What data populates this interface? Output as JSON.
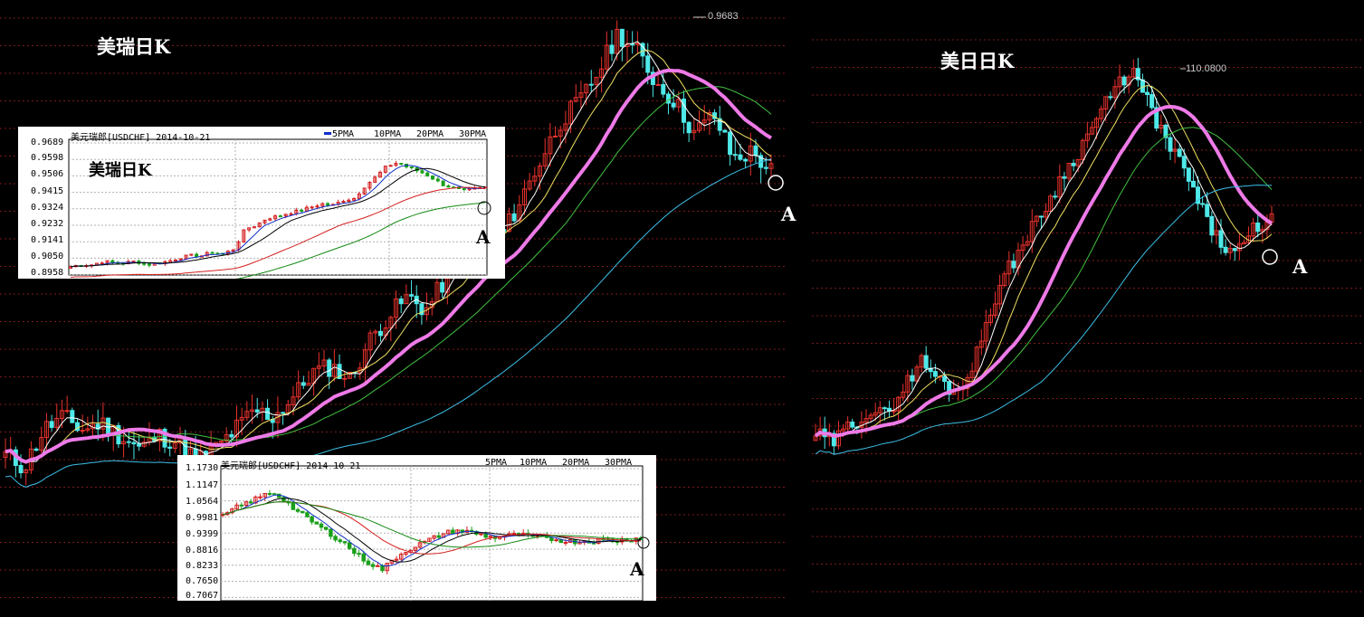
{
  "colors": {
    "bg": "#000000",
    "up": "#e8322c",
    "down": "#4ee8e8",
    "ma5": "#ffffff",
    "ma10": "#f0e060",
    "ma20": "#e84a8c",
    "ma30": "#40c040",
    "ma60": "#3cc0e8",
    "thick": "#ee7ae8",
    "inset_ma5": "#1030c8",
    "inset_ma10": "#000000",
    "inset_ma20": "#d42020",
    "inset_ma30": "#148a14"
  },
  "left_chart": {
    "title": "美瑞日K",
    "peak_label": "0.9683",
    "marker": "A"
  },
  "right_chart": {
    "title": "美日日K",
    "peak_label": "110.0800",
    "marker": "A"
  },
  "inset_chf": {
    "header": "美元瑞郎[USDCHF] 2014-10-21",
    "legend": [
      "5PMA",
      "10PMA",
      "20PMA",
      "30PMA"
    ],
    "yticks": [
      "0.9689",
      "0.9598",
      "0.9506",
      "0.9415",
      "0.9324",
      "0.9232",
      "0.9141",
      "0.9050",
      "0.8958"
    ],
    "title": "美瑞日K",
    "marker": "A"
  },
  "inset_long": {
    "header": "美元瑞郎[USDCHF] 2014-10-21",
    "legend": [
      "5PMA",
      "10PMA",
      "20PMA",
      "30PMA"
    ],
    "yticks": [
      "1.1730",
      "1.1147",
      "1.0564",
      "0.9981",
      "0.9399",
      "0.8816",
      "0.8233",
      "0.7650",
      "0.7067"
    ],
    "marker": "A"
  },
  "chart_data": [
    {
      "type": "candlestick",
      "title": "美瑞日K",
      "peak_label": "0.9683",
      "close_path": [
        0.899,
        0.897,
        0.903,
        0.905,
        0.903,
        0.904,
        0.902,
        0.9,
        0.902,
        0.901,
        0.898,
        0.9,
        0.903,
        0.906,
        0.905,
        0.908,
        0.912,
        0.913,
        0.911,
        0.917,
        0.921,
        0.924,
        0.922,
        0.927,
        0.932,
        0.936,
        0.934,
        0.94,
        0.946,
        0.952,
        0.955,
        0.96,
        0.966,
        0.963,
        0.958,
        0.955,
        0.95,
        0.953,
        0.946,
        0.947,
        0.944
      ],
      "markers": [
        "A"
      ]
    },
    {
      "type": "candlestick",
      "title": "美日日K",
      "peak_label": "110.0800",
      "close_path": [
        102.0,
        101.8,
        102.2,
        102.5,
        102.4,
        103.0,
        103.6,
        103.2,
        102.9,
        103.5,
        104.8,
        105.6,
        106.3,
        106.9,
        107.6,
        108.2,
        108.9,
        109.5,
        110.0,
        109.2,
        108.4,
        107.8,
        106.9,
        106.2,
        105.9,
        106.5,
        106.7
      ],
      "markers": [
        "A"
      ]
    },
    {
      "type": "candlestick",
      "title": "美瑞日K",
      "series": [
        {
          "name": "5PMA"
        },
        {
          "name": "10PMA"
        },
        {
          "name": "20PMA"
        },
        {
          "name": "30PMA"
        }
      ],
      "ylim": [
        0.8958,
        0.9689
      ],
      "close_path": [
        0.9,
        0.901,
        0.901,
        0.903,
        0.902,
        0.902,
        0.903,
        0.901,
        0.902,
        0.903,
        0.905,
        0.906,
        0.906,
        0.908,
        0.907,
        0.91,
        0.921,
        0.923,
        0.927,
        0.928,
        0.93,
        0.931,
        0.933,
        0.935,
        0.934,
        0.937,
        0.938,
        0.945,
        0.95,
        0.956,
        0.958,
        0.955,
        0.953,
        0.95,
        0.946,
        0.944,
        0.942,
        0.943,
        0.944
      ],
      "markers": [
        "A"
      ]
    },
    {
      "type": "candlestick",
      "series": [
        {
          "name": "5PMA"
        },
        {
          "name": "10PMA"
        },
        {
          "name": "20PMA"
        },
        {
          "name": "30PMA"
        }
      ],
      "ylim": [
        0.7067,
        1.173
      ],
      "close_path": [
        1.0,
        1.03,
        1.05,
        1.07,
        1.09,
        1.06,
        1.02,
        0.99,
        0.96,
        0.93,
        0.9,
        0.86,
        0.83,
        0.81,
        0.85,
        0.88,
        0.9,
        0.92,
        0.94,
        0.95,
        0.945,
        0.935,
        0.925,
        0.93,
        0.935,
        0.928,
        0.922,
        0.918,
        0.912,
        0.91,
        0.912,
        0.916,
        0.914,
        0.918,
        0.924
      ],
      "markers": [
        "A"
      ]
    }
  ]
}
